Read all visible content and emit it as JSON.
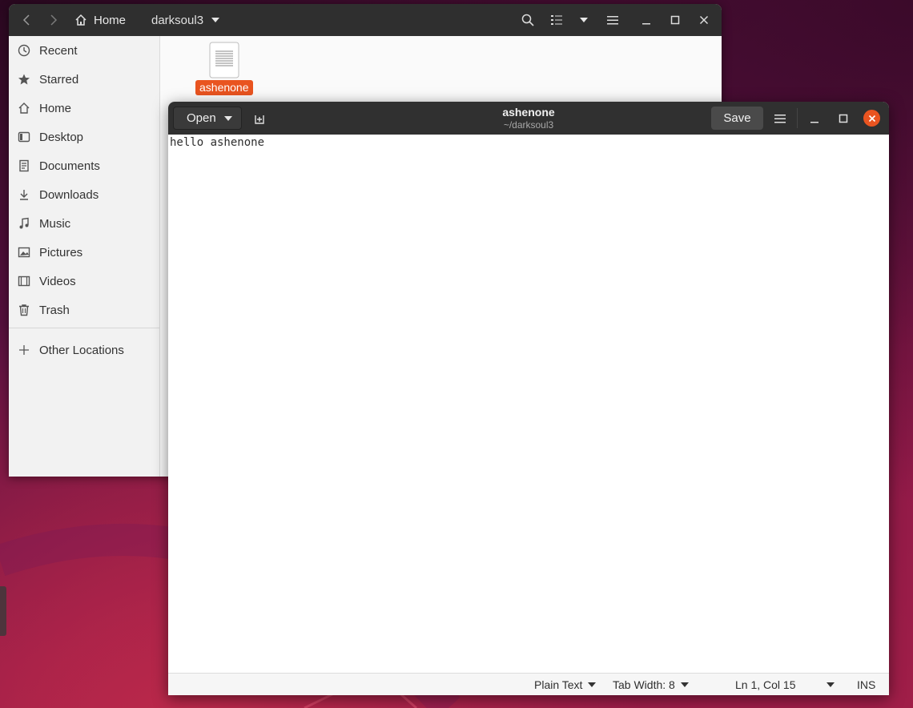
{
  "files": {
    "path_home_label": "Home",
    "path_current_label": "darksoul3",
    "sidebar": {
      "items": [
        {
          "label": "Recent",
          "icon": "clock-icon"
        },
        {
          "label": "Starred",
          "icon": "star-icon"
        },
        {
          "label": "Home",
          "icon": "home-icon"
        },
        {
          "label": "Desktop",
          "icon": "desktop-icon"
        },
        {
          "label": "Documents",
          "icon": "document-icon"
        },
        {
          "label": "Downloads",
          "icon": "download-icon"
        },
        {
          "label": "Music",
          "icon": "music-icon"
        },
        {
          "label": "Pictures",
          "icon": "picture-icon"
        },
        {
          "label": "Videos",
          "icon": "video-icon"
        },
        {
          "label": "Trash",
          "icon": "trash-icon"
        }
      ],
      "other_locations": "Other Locations"
    },
    "file": {
      "name": "ashenone",
      "selected": true
    }
  },
  "editor": {
    "open_label": "Open",
    "title": "ashenone",
    "subtitle": "~/darksoul3",
    "save_label": "Save",
    "content": "hello ashenone",
    "status": {
      "language": "Plain Text",
      "tab_width": "Tab Width: 8",
      "cursor": "Ln 1, Col 15",
      "mode": "INS"
    }
  },
  "colors": {
    "accent": "#e95420",
    "headerbar": "#2f2f2f"
  }
}
